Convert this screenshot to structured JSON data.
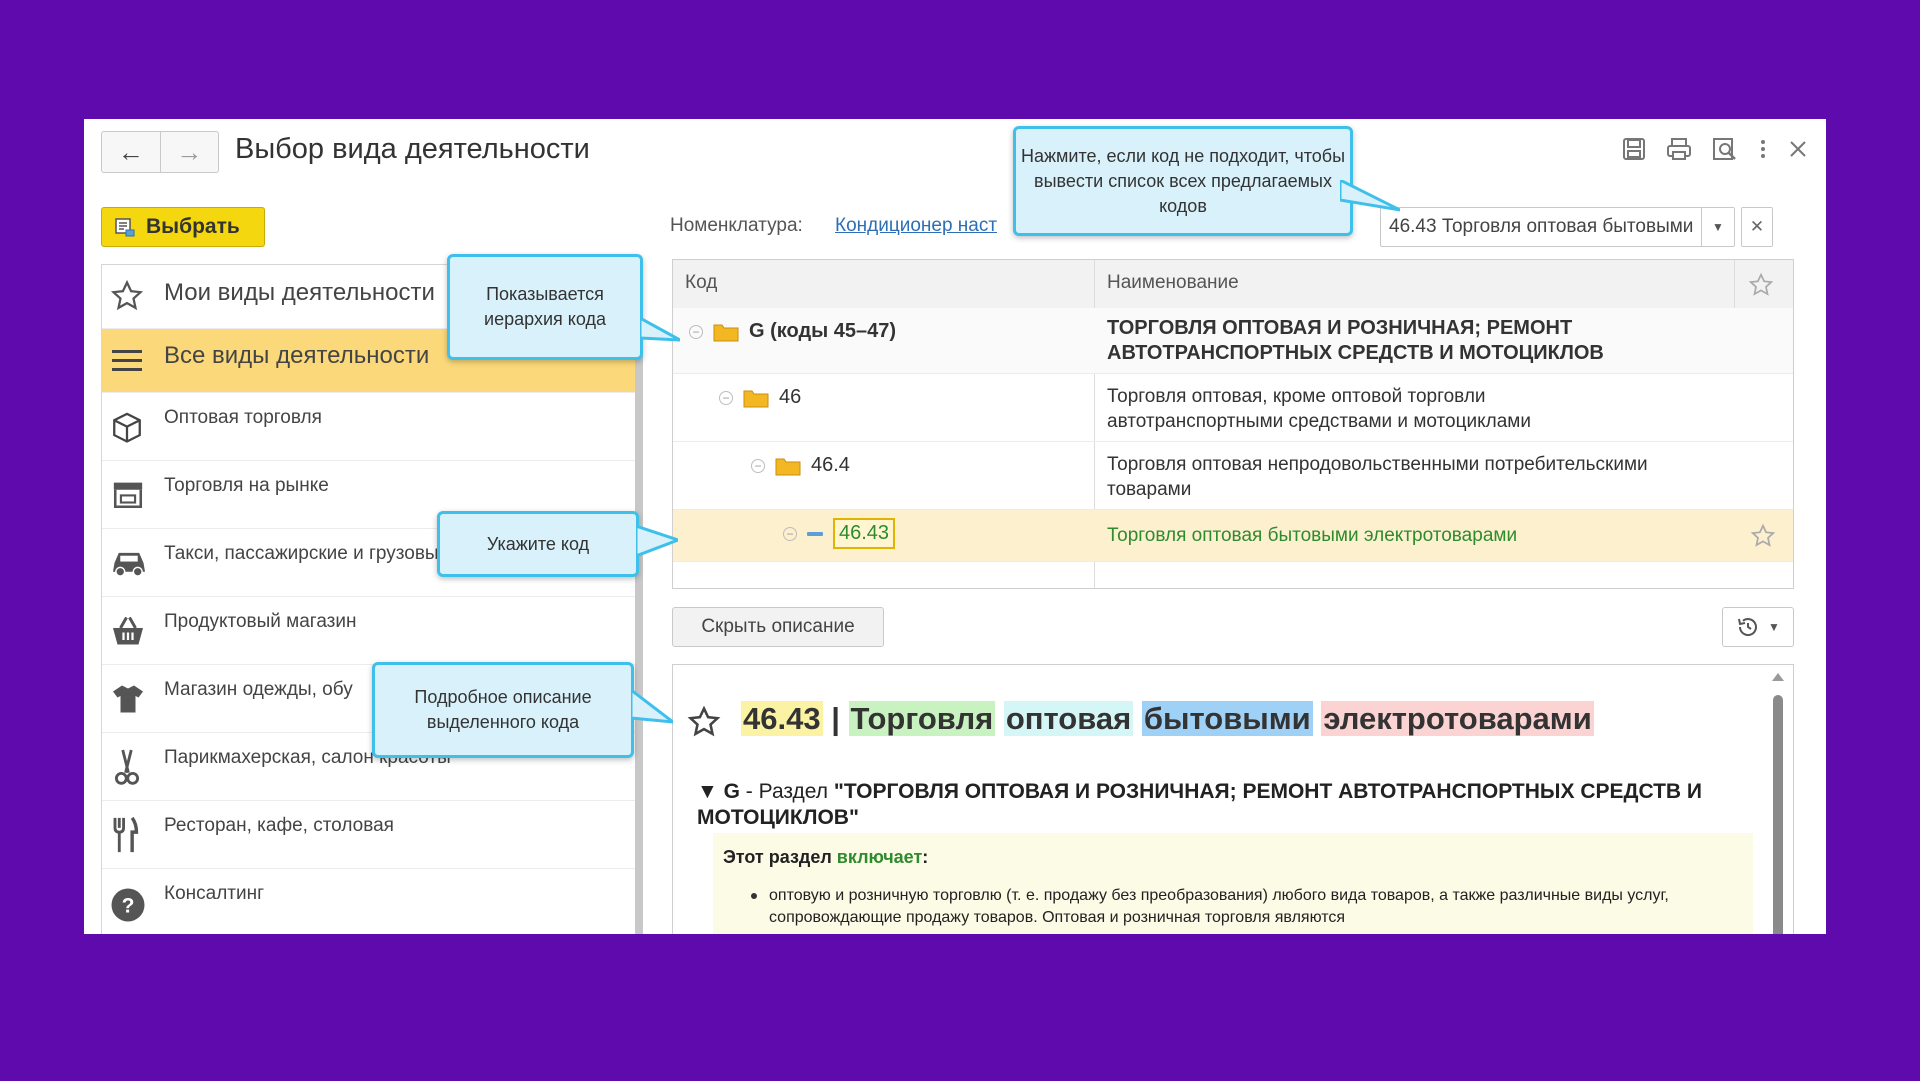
{
  "window": {
    "title": "Выбор вида деятельности",
    "select_label": "Выбрать"
  },
  "sidebar": {
    "items": [
      {
        "label": "Мои виды деятельности",
        "icon": "star-icon"
      },
      {
        "label": "Все виды деятельности",
        "icon": "menu-icon"
      },
      {
        "label": "Оптовая торговля",
        "icon": "box-icon"
      },
      {
        "label": "Торговля на рынке",
        "icon": "market-stall-icon"
      },
      {
        "label": "Такси, пассажирские и грузовые перевозки",
        "icon": "car-icon"
      },
      {
        "label": "Продуктовый магазин",
        "icon": "basket-icon"
      },
      {
        "label": "Магазин одежды, обу",
        "icon": "clothing-icon"
      },
      {
        "label": "Парикмахерская, салон красоты",
        "icon": "scissors-icon"
      },
      {
        "label": "Ресторан, кафе, столовая",
        "icon": "fork-knife-icon"
      },
      {
        "label": "Консалтинг",
        "icon": "question-icon"
      }
    ]
  },
  "filter": {
    "label": "Номенклатура:",
    "link": "Кондиционер наст",
    "code_value": "46.43 Торговля оптовая бытовыми"
  },
  "table": {
    "columns": [
      "Код",
      "Наименование"
    ],
    "rows": [
      {
        "code": "G (коды 45–47)",
        "name": "ТОРГОВЛЯ ОПТОВАЯ И РОЗНИЧНАЯ; РЕМОНТ АВТОТРАНСПОРТНЫХ СРЕДСТВ И МОТОЦИКЛОВ"
      },
      {
        "code": "46",
        "name": "Торговля оптовая, кроме оптовой торговли автотранспортными средствами и мотоциклами"
      },
      {
        "code": "46.4",
        "name": "Торговля оптовая непродовольственными потребительскими товарами"
      },
      {
        "code": "46.43",
        "name": "Торговля оптовая бытовыми электротоварами"
      }
    ]
  },
  "description": {
    "hide_label": "Скрыть описание",
    "title_code": "46.43",
    "title_sep": "|",
    "title_words": [
      "Торговля",
      "оптовая",
      "бытовыми",
      "электротоварами"
    ],
    "section_prefix": "▼ G",
    "section_mid": " - Раздел ",
    "section_title": "\"ТОРГОВЛЯ ОПТОВАЯ И РОЗНИЧНАЯ; РЕМОНТ АВТОТРАНСПОРТНЫХ СРЕДСТВ И МОТОЦИКЛОВ\"",
    "includes_prefix": "Этот раздел ",
    "includes_word": "включает",
    "includes_suffix": ":",
    "bullet_text": "оптовую и розничную торговлю (т. е. продажу без преобразования) любого вида товаров, а также различные виды услуг, сопровождающие продажу товаров. Оптовая и розничная торговля являются"
  },
  "callouts": {
    "hierarchy": "Показывается иерархия кода",
    "specify": "Укажите код",
    "details": "Подробное описание выделенного кода",
    "hint": "Нажмите, если код не подходит, чтобы вывести список всех предлагаемых кодов"
  },
  "colors": {
    "background": "#5e0aac",
    "accent_yellow": "#f5d70f",
    "selected_row": "#fdf0cf",
    "callout_border": "#3fc0ea",
    "green_text": "#2e8b2e"
  }
}
